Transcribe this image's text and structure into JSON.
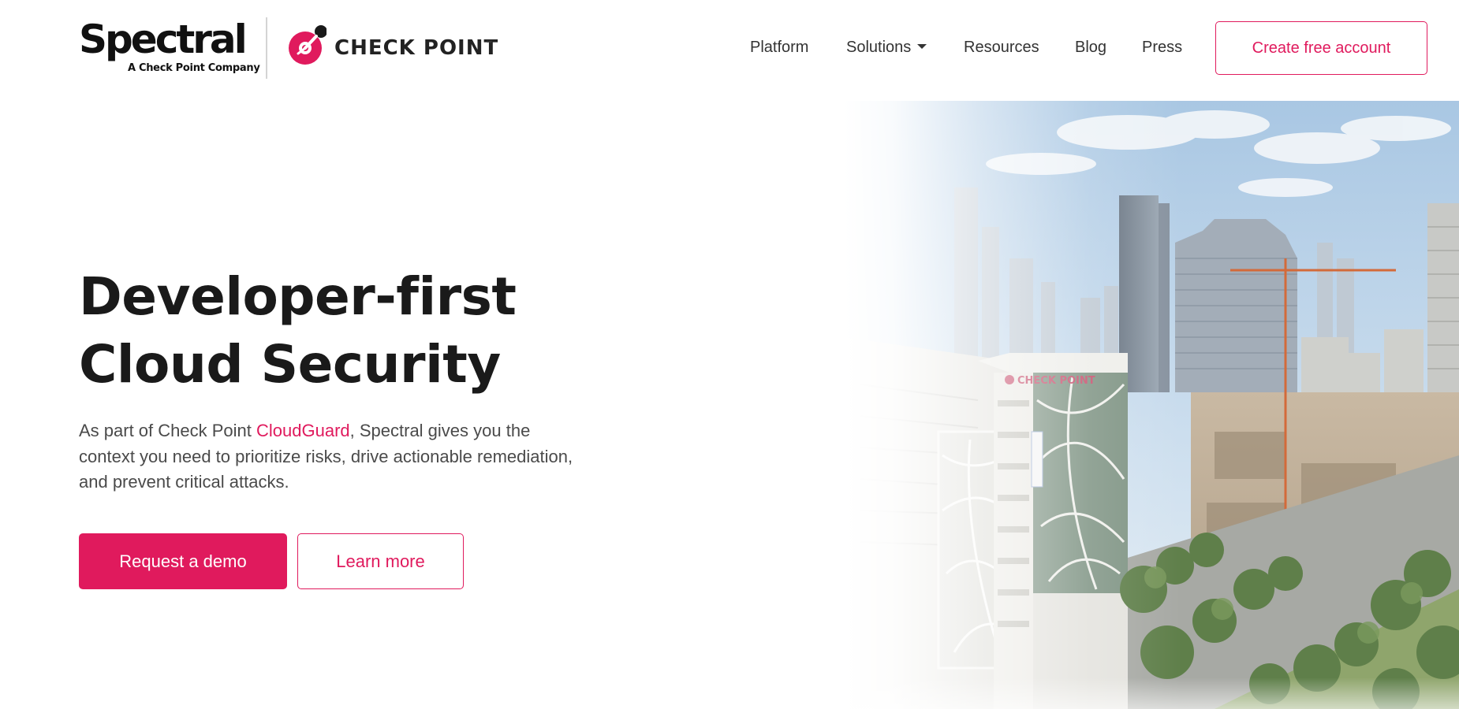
{
  "brand": {
    "name": "Spectral",
    "tagline": "A Check Point Company",
    "partner_name": "CHECK POINT",
    "partner_tm": "™",
    "accent_color": "#e01a5d"
  },
  "nav": {
    "items": [
      {
        "label": "Platform"
      },
      {
        "label": "Solutions",
        "has_dropdown": true
      },
      {
        "label": "Resources"
      },
      {
        "label": "Blog"
      },
      {
        "label": "Press"
      }
    ],
    "cta_label": "Create free account"
  },
  "hero": {
    "title_line1": "Developer-first",
    "title_line2": "Cloud Security",
    "description_pre": "As part of Check Point ",
    "description_link": "CloudGuard",
    "description_post": ", Spectral gives you the context you need to prioritize risks, drive actionable remediation, and prevent critical attacks.",
    "primary_button": "Request a demo",
    "secondary_button": "Learn more",
    "image_sign_text": "CHECK POINT"
  },
  "icons": {
    "dropdown": "chevron-down-icon",
    "partner_logo": "check-point-logo-icon"
  }
}
